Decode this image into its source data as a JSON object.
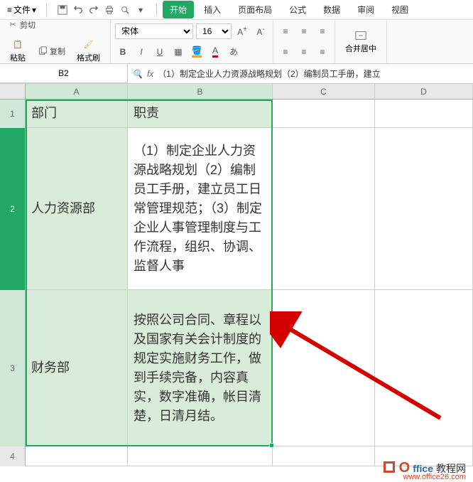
{
  "menu": {
    "file": "文件",
    "tabs": [
      "开始",
      "插入",
      "页面布局",
      "公式",
      "数据",
      "审阅",
      "视图"
    ],
    "active_tab_index": 0
  },
  "quick_access": {
    "menu_icon": "≡",
    "dropdown_icon": "▾"
  },
  "toolbar": {
    "cut": "剪切",
    "copy": "复制",
    "paste": "粘贴",
    "format_painter": "格式刷",
    "font_name": "宋体",
    "font_size": "16",
    "merge_center": "合并居中"
  },
  "name_box": {
    "value": "B2"
  },
  "formula_bar": {
    "fx": "fx",
    "value": "（1）制定企业人力资源战略规划（2）编制员工手册，建立"
  },
  "columns": [
    "A",
    "B",
    "C",
    "D"
  ],
  "col_widths": {
    "A": 144,
    "B": 204,
    "C": 144,
    "D": 138
  },
  "rows": [
    {
      "num": "1",
      "cells": {
        "A": "部门",
        "B": "职责",
        "C": "",
        "D": ""
      }
    },
    {
      "num": "2",
      "cells": {
        "A": "人力资源部",
        "B": "（1）制定企业人力资源战略规划（2）编制员工手册，建立员工日常管理规范；（3）制定企业人事管理制度与工作流程，组织、协调、监督人事",
        "C": "",
        "D": ""
      }
    },
    {
      "num": "3",
      "cells": {
        "A": "财务部",
        "B": "按照公司合同、章程以及国家有关会计制度的规定实施财务工作，做到手续完备，内容真实，数字准确，帐目清楚，日清月结。",
        "C": "",
        "D": ""
      }
    },
    {
      "num": "4",
      "cells": {
        "A": "",
        "B": "",
        "C": "",
        "D": ""
      }
    }
  ],
  "watermark": {
    "title": "Office教程网",
    "url": "www.office26.com"
  }
}
